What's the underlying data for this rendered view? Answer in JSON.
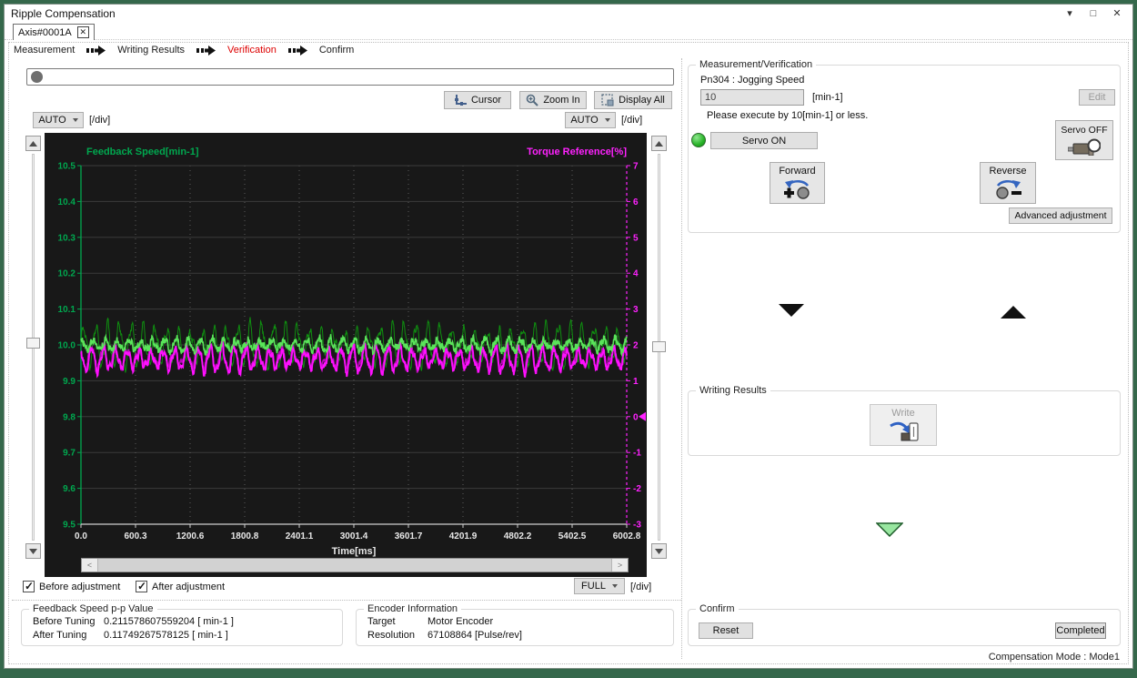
{
  "window": {
    "title": "Ripple Compensation",
    "min_glyph": "▾",
    "max_glyph": "□",
    "close_glyph": "✕"
  },
  "tab": {
    "label": "Axis#0001A",
    "close_glyph": "✕"
  },
  "steps": {
    "items": [
      "Measurement",
      "Writing Results",
      "Verification",
      "Confirm"
    ],
    "active_index": 2
  },
  "toolbar": {
    "cursor": "Cursor",
    "zoom_in": "Zoom In",
    "display_all": "Display All"
  },
  "scales": {
    "left": "AUTO",
    "right": "AUTO",
    "bottom": "FULL",
    "per_div": "[/div]"
  },
  "chart_data": {
    "type": "line",
    "title_left": "Feedback Speed[min-1]",
    "title_right": "Torque Reference[%]",
    "xlabel": "Time[ms]",
    "x_ticks": [
      "0.0",
      "600.3",
      "1200.6",
      "1800.8",
      "2401.1",
      "3001.4",
      "3601.7",
      "4201.9",
      "4802.2",
      "5402.5",
      "6002.8"
    ],
    "x_range_ms": [
      0,
      6002.8
    ],
    "y_left": {
      "range": [
        9.5,
        10.5
      ],
      "ticks": [
        "10.5",
        "10.4",
        "10.3",
        "10.2",
        "10.1",
        "10.0",
        "9.9",
        "9.8",
        "9.7",
        "9.6",
        "9.5"
      ],
      "color": "#00a84f"
    },
    "y_right": {
      "range": [
        -3,
        7
      ],
      "ticks": [
        "7",
        "6",
        "5",
        "4",
        "3",
        "2",
        "1",
        "0",
        "-1",
        "-2",
        "-3"
      ],
      "color": "#ff22ff"
    },
    "right_marker_value": 0,
    "grid": {
      "h_color": "#3b3b3b",
      "v_color": "#5c5c5c",
      "bg": "#181818",
      "x_text": "#e8e8e8"
    },
    "series": [
      {
        "name": "Feedback Speed (Before adjustment)",
        "axis": "left",
        "color": "#0f9010",
        "mean": 10.0,
        "amplitude": 0.045,
        "cycles": 46,
        "noise": 0.007,
        "phase": 0.0,
        "width": 1
      },
      {
        "name": "Torque Reference (Before adjustment)",
        "axis": "right",
        "color": "#b80ab8",
        "mean": 1.65,
        "amplitude": 0.26,
        "cycles": 46,
        "noise": 0.06,
        "phase": 2.4,
        "width": 1.6
      },
      {
        "name": "Torque Reference (After adjustment)",
        "axis": "right",
        "color": "#ff10ff",
        "mean": 1.6,
        "amplitude": 0.28,
        "cycles": 46,
        "noise": 0.07,
        "phase": 2.1,
        "width": 1.8
      },
      {
        "name": "Feedback Speed (After adjustment)",
        "axis": "left",
        "color": "#5ae45a",
        "mean": 10.0,
        "amplitude": 0.014,
        "cycles": 46,
        "noise": 0.01,
        "phase": 1.2,
        "width": 1.6
      }
    ],
    "scrollbar": {
      "left_glyph": "<",
      "right_glyph": ">"
    }
  },
  "legend_checkboxes": [
    {
      "label": "Before adjustment",
      "checked": true
    },
    {
      "label": "After adjustment",
      "checked": true
    }
  ],
  "measurement_panel": {
    "title": "Measurement/Verification",
    "param_label": "Pn304 : Jogging Speed",
    "param_value": "10",
    "param_unit": "[min-1]",
    "edit_button": "Edit",
    "note": "Please execute by 10[min-1] or less.",
    "servo_on": "Servo ON",
    "servo_off": "Servo OFF",
    "forward": "Forward",
    "reverse": "Reverse",
    "advanced": "Advanced adjustment"
  },
  "writing_panel": {
    "title": "Writing Results",
    "write": "Write"
  },
  "pp_panel": {
    "title": "Feedback Speed p-p Value",
    "rows": [
      {
        "label": "Before Tuning",
        "value": "0.211578607559204",
        "unit": "[ min-1 ]"
      },
      {
        "label": "After Tuning",
        "value": "0.11749267578125",
        "unit": "[ min-1 ]"
      }
    ]
  },
  "encoder_panel": {
    "title": "Encoder Information",
    "rows": [
      {
        "label": "Target",
        "value": "Motor Encoder"
      },
      {
        "label": "Resolution",
        "value": "67108864 [Pulse/rev]"
      }
    ]
  },
  "confirm_panel": {
    "title": "Confirm",
    "reset": "Reset",
    "completed": "Completed"
  },
  "footer": {
    "compensation_mode": "Compensation Mode : Mode1"
  }
}
